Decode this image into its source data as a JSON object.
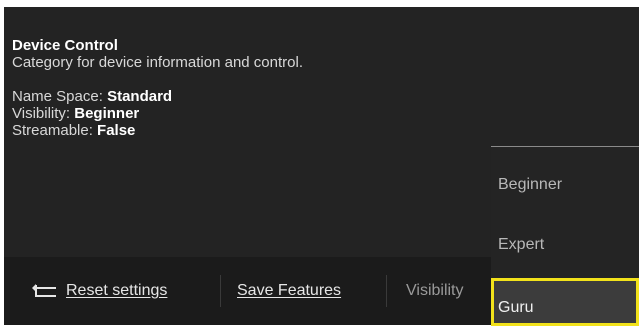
{
  "info": {
    "title": "Device Control",
    "description": "Category for device information and control.",
    "name_space_label": "Name Space:",
    "name_space_value": "Standard",
    "visibility_label": "Visibility:",
    "visibility_value": "Beginner",
    "streamable_label": "Streamable:",
    "streamable_value": "False"
  },
  "toolbar": {
    "reset_label": "Reset settings",
    "save_label": "Save Features",
    "visibility_label": "Visibility"
  },
  "dropdown": {
    "options": [
      "Beginner",
      "Expert",
      "Guru"
    ],
    "selected": "Guru"
  },
  "colors": {
    "panel_bg": "#232323",
    "toolbar_bg": "#1b1b1b",
    "highlight": "#f2e21b"
  },
  "icons": {
    "reset": "reset-arrow-icon"
  }
}
